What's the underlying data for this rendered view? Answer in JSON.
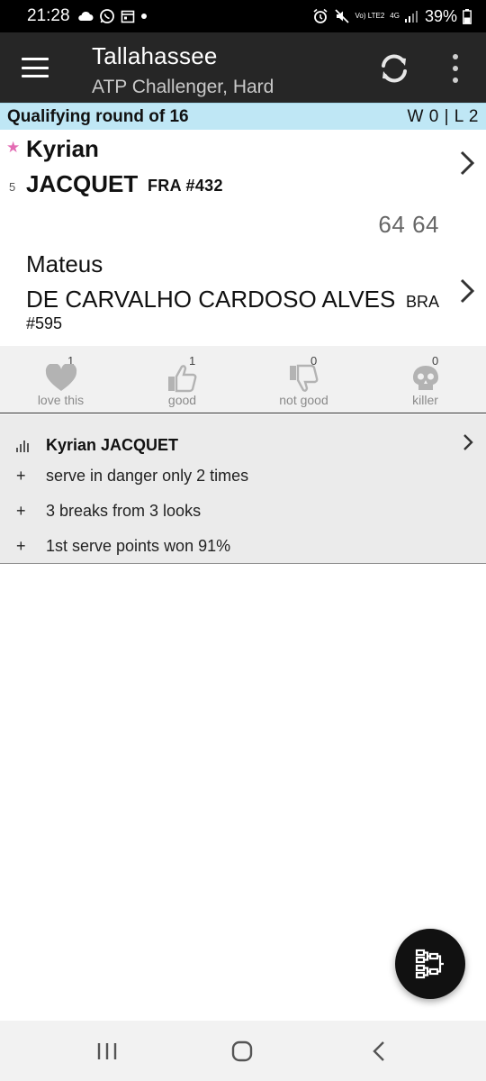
{
  "status_bar": {
    "time": "21:28",
    "battery": "39%",
    "volte": "Vo) LTE2",
    "network": "4G"
  },
  "app_bar": {
    "title": "Tallahassee",
    "subtitle": "ATP Challenger, Hard"
  },
  "round": {
    "label": "Qualifying round of 16",
    "record": "W 0 | L 2"
  },
  "match": {
    "player1": {
      "seed": "5",
      "first_name": "Kyrian",
      "last_name": "JACQUET",
      "meta": "FRA #432"
    },
    "score": "64 64",
    "player2": {
      "first_name": "Mateus",
      "last_name": "DE CARVALHO CARDOSO ALVES",
      "country": "BRA",
      "rank": "#595"
    }
  },
  "reactions": [
    {
      "label": "love this",
      "count": "1",
      "icon": "heart-icon"
    },
    {
      "label": "good",
      "count": "1",
      "icon": "thumbs-up-icon"
    },
    {
      "label": "not good",
      "count": "0",
      "icon": "thumbs-down-icon"
    },
    {
      "label": "killer",
      "count": "0",
      "icon": "skull-icon"
    }
  ],
  "summary": {
    "title": "Kyrian JACQUET",
    "items": [
      "serve in danger only 2 times",
      "3 breaks from 3 looks",
      "1st serve points won 91%"
    ],
    "bullet": "+"
  },
  "colors": {
    "app_bar_bg": "#262626",
    "round_bar_bg": "#bfe7f5",
    "star": "#e36bb3",
    "reactions_bg": "#f1f1f1",
    "summary_bg": "#ebebeb"
  }
}
